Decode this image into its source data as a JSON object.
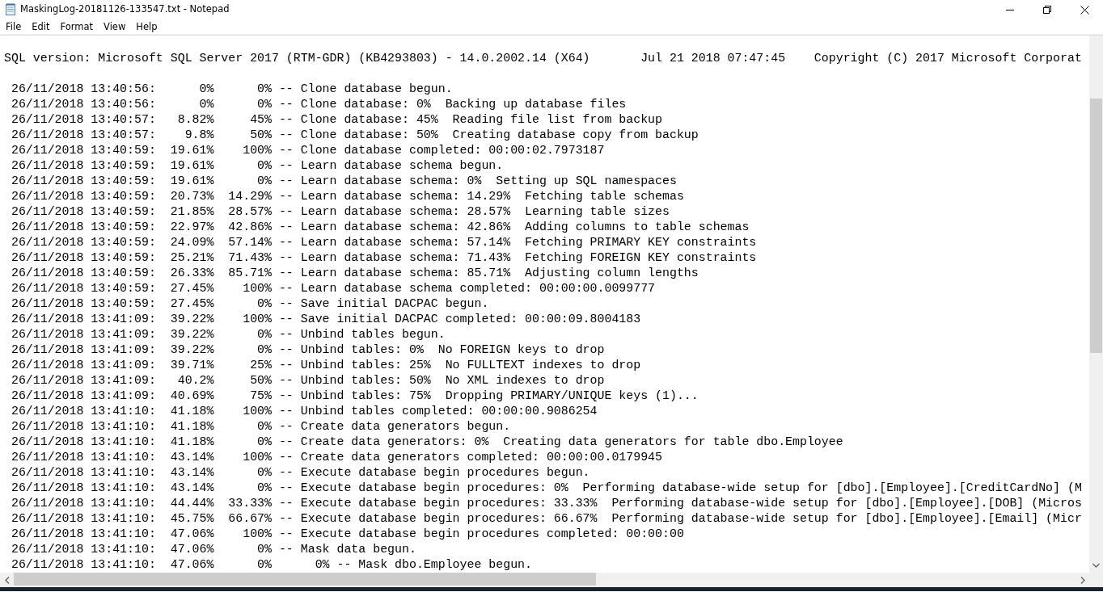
{
  "window": {
    "title": "MaskingLog-20181126-133547.txt - Notepad"
  },
  "menu": [
    "File",
    "Edit",
    "Format",
    "View",
    "Help"
  ],
  "document": {
    "header_line": "SQL version: Microsoft SQL Server 2017 (RTM-GDR) (KB4293803) - 14.0.2002.14 (X64)       Jul 21 2018 07:47:45    Copyright (C) 2017 Microsoft Corporat",
    "log_lines": [
      " 26/11/2018 13:40:56:      0%      0% -- Clone database begun.",
      " 26/11/2018 13:40:56:      0%      0% -- Clone database: 0%  Backing up database files",
      " 26/11/2018 13:40:57:   8.82%     45% -- Clone database: 45%  Reading file list from backup",
      " 26/11/2018 13:40:57:    9.8%     50% -- Clone database: 50%  Creating database copy from backup",
      " 26/11/2018 13:40:59:  19.61%    100% -- Clone database completed: 00:00:02.7973187",
      " 26/11/2018 13:40:59:  19.61%      0% -- Learn database schema begun.",
      " 26/11/2018 13:40:59:  19.61%      0% -- Learn database schema: 0%  Setting up SQL namespaces",
      " 26/11/2018 13:40:59:  20.73%  14.29% -- Learn database schema: 14.29%  Fetching table schemas",
      " 26/11/2018 13:40:59:  21.85%  28.57% -- Learn database schema: 28.57%  Learning table sizes",
      " 26/11/2018 13:40:59:  22.97%  42.86% -- Learn database schema: 42.86%  Adding columns to table schemas",
      " 26/11/2018 13:40:59:  24.09%  57.14% -- Learn database schema: 57.14%  Fetching PRIMARY KEY constraints",
      " 26/11/2018 13:40:59:  25.21%  71.43% -- Learn database schema: 71.43%  Fetching FOREIGN KEY constraints",
      " 26/11/2018 13:40:59:  26.33%  85.71% -- Learn database schema: 85.71%  Adjusting column lengths",
      " 26/11/2018 13:40:59:  27.45%    100% -- Learn database schema completed: 00:00:00.0099777",
      " 26/11/2018 13:40:59:  27.45%      0% -- Save initial DACPAC begun.",
      " 26/11/2018 13:41:09:  39.22%    100% -- Save initial DACPAC completed: 00:00:09.8004183",
      " 26/11/2018 13:41:09:  39.22%      0% -- Unbind tables begun.",
      " 26/11/2018 13:41:09:  39.22%      0% -- Unbind tables: 0%  No FOREIGN keys to drop",
      " 26/11/2018 13:41:09:  39.71%     25% -- Unbind tables: 25%  No FULLTEXT indexes to drop",
      " 26/11/2018 13:41:09:   40.2%     50% -- Unbind tables: 50%  No XML indexes to drop",
      " 26/11/2018 13:41:09:  40.69%     75% -- Unbind tables: 75%  Dropping PRIMARY/UNIQUE keys (1)...",
      " 26/11/2018 13:41:10:  41.18%    100% -- Unbind tables completed: 00:00:00.9086254",
      " 26/11/2018 13:41:10:  41.18%      0% -- Create data generators begun.",
      " 26/11/2018 13:41:10:  41.18%      0% -- Create data generators: 0%  Creating data generators for table dbo.Employee",
      " 26/11/2018 13:41:10:  43.14%    100% -- Create data generators completed: 00:00:00.0179945",
      " 26/11/2018 13:41:10:  43.14%      0% -- Execute database begin procedures begun.",
      " 26/11/2018 13:41:10:  43.14%      0% -- Execute database begin procedures: 0%  Performing database-wide setup for [dbo].[Employee].[CreditCardNo] (M",
      " 26/11/2018 13:41:10:  44.44%  33.33% -- Execute database begin procedures: 33.33%  Performing database-wide setup for [dbo].[Employee].[DOB] (Micros",
      " 26/11/2018 13:41:10:  45.75%  66.67% -- Execute database begin procedures: 66.67%  Performing database-wide setup for [dbo].[Employee].[Email] (Micr",
      " 26/11/2018 13:41:10:  47.06%    100% -- Execute database begin procedures completed: 00:00:00",
      " 26/11/2018 13:41:10:  47.06%      0% -- Mask data begun.",
      " 26/11/2018 13:41:10:  47.06%      0%      0% -- Mask dbo.Employee begun."
    ]
  }
}
